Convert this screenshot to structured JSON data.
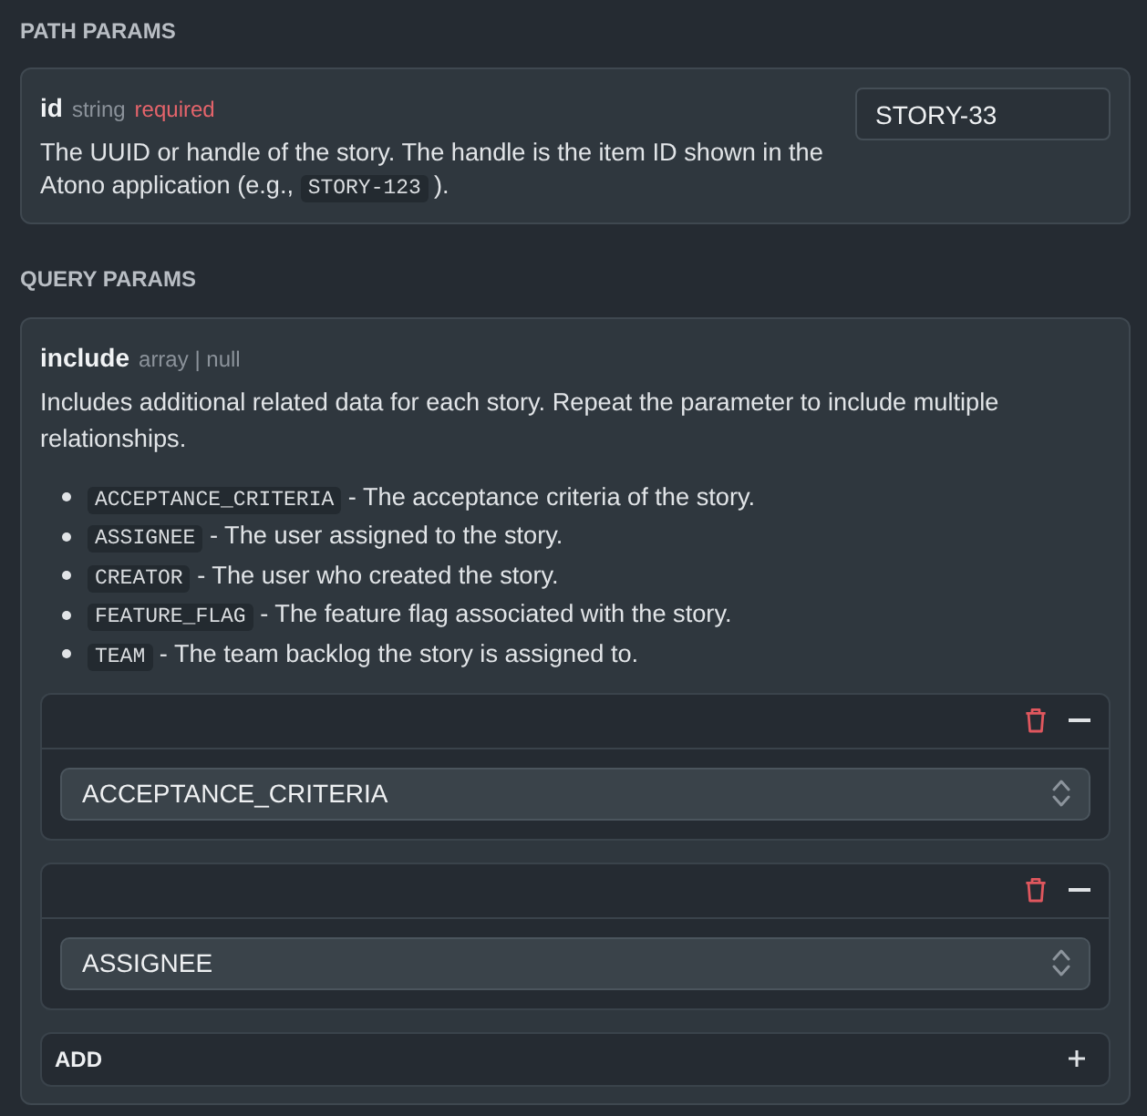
{
  "sections": [
    {
      "title": "PATH PARAMS",
      "params": [
        {
          "name": "id",
          "type": "string",
          "required_label": "required",
          "description": [
            {
              "kind": "text",
              "text": "The UUID or handle of the story. The handle is the item ID shown in the Atono application (e.g., "
            },
            {
              "kind": "code",
              "text": "STORY-123"
            },
            {
              "kind": "text",
              "text": ")."
            }
          ],
          "value": "STORY-33"
        }
      ]
    },
    {
      "title": "QUERY PARAMS",
      "params": [
        {
          "name": "include",
          "type": "array | null",
          "description": [
            {
              "kind": "text",
              "text": "Includes additional related data for each story. Repeat the parameter to include multiple relationships."
            }
          ],
          "options": [
            {
              "code": "ACCEPTANCE_CRITERIA",
              "text": "- The acceptance criteria of the story."
            },
            {
              "code": "ASSIGNEE",
              "text": "- The user assigned to the story."
            },
            {
              "code": "CREATOR",
              "text": "- The user who created the story."
            },
            {
              "code": "FEATURE_FLAG",
              "text": "- The feature flag associated with the story."
            },
            {
              "code": "TEAM",
              "text": "- The team backlog the story is assigned to."
            }
          ],
          "items": [
            {
              "value": "ACCEPTANCE_CRITERIA",
              "expanded": true
            },
            {
              "value": "ASSIGNEE",
              "expanded": true
            }
          ],
          "add_label": "ADD"
        }
      ]
    }
  ]
}
